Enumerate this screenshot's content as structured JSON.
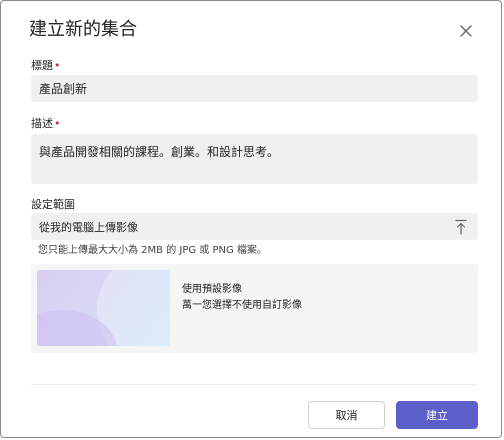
{
  "dialog": {
    "title": "建立新的集合",
    "close_icon": "close-icon"
  },
  "fields": {
    "title_label": "標題",
    "title_value": "產品創新",
    "description_label": "描述",
    "description_value": "與產品開發相關的課程。創業。和設計思考。",
    "required_marker": "•"
  },
  "cover": {
    "label": "設定範圍",
    "upload_text": "從我的電腦上傳影像",
    "upload_icon": "upload-icon",
    "hint": "您只能上傳最大大小為 2MB 的 JPG 或 PNG 檔案。",
    "default_title": "使用預設影像",
    "default_subtitle": "萬一您選擇不使用自訂影像"
  },
  "buttons": {
    "cancel": "取消",
    "create": "建立"
  },
  "colors": {
    "accent": "#5b5fc7",
    "field_bg": "#f0f0f0",
    "required": "#c4314b"
  }
}
